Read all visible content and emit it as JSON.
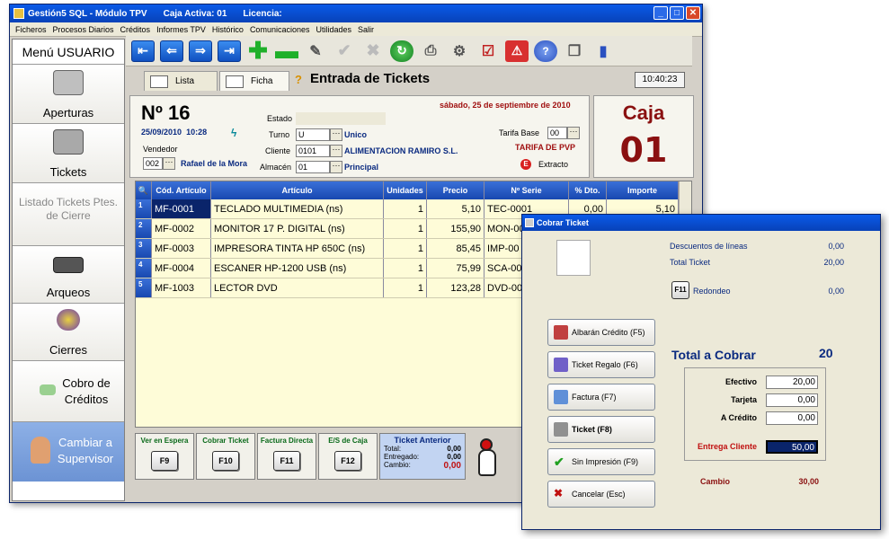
{
  "window": {
    "app_title": "Gestión5 SQL - Módulo TPV",
    "caja_activa": "Caja Activa: 01",
    "licencia": "Licencia:"
  },
  "menu": [
    "Ficheros",
    "Procesos Diarios",
    "Créditos",
    "Informes TPV",
    "Histórico",
    "Comunicaciones",
    "Utilidades",
    "Salir"
  ],
  "sidebar": {
    "title": "Menú USUARIO",
    "items": [
      {
        "label": "Aperturas",
        "icon": "register-icon"
      },
      {
        "label": "Tickets",
        "icon": "cash-register-icon"
      },
      {
        "label": "Listado Tickets Ptes. de Cierre",
        "icon": ""
      },
      {
        "label": "Arqueos",
        "icon": "cash-drawer-icon"
      },
      {
        "label": "Cierres",
        "icon": "gears-icon"
      },
      {
        "label": "Cobro de Créditos",
        "icon": "money-icon"
      },
      {
        "label": "Cambiar a Supervisor",
        "icon": "user-icon"
      }
    ]
  },
  "tabs": {
    "lista": "Lista",
    "ficha": "Ficha"
  },
  "page_title": "Entrada de Tickets",
  "clock": "10:40:23",
  "ticket": {
    "number": "Nº 16",
    "date": "25/09/2010",
    "time": "10:28",
    "long_date": "sábado, 25 de septiembre de 2010",
    "vendedor_label": "Vendedor",
    "vendedor_code": "002",
    "vendedor_name": "Rafael de la Mora",
    "estado_label": "Estado",
    "turno_label": "Turno",
    "turno_code": "U",
    "turno_name": "Unico",
    "cliente_label": "Cliente",
    "cliente_code": "0101",
    "cliente_name": "ALIMENTACION RAMIRO S.L.",
    "almacen_label": "Almacén",
    "almacen_code": "01",
    "almacen_name": "Principal",
    "tarifa_label": "Tarifa Base",
    "tarifa_code": "00",
    "tarifa_name": "TARIFA DE PVP",
    "extracto": "Extracto"
  },
  "caja": {
    "label": "Caja",
    "number": "01"
  },
  "grid": {
    "headers": [
      "Cód. Artículo",
      "Artículo",
      "Unidades",
      "Precio",
      "Nº Serie",
      "% Dto.",
      "Importe"
    ],
    "rows": [
      {
        "n": "1",
        "cod": "MF-0001",
        "art": "TECLADO MULTIMEDIA  (ns)",
        "uni": "1",
        "precio": "5,10",
        "serie": "TEC-0001",
        "dto": "0,00",
        "imp": "5,10"
      },
      {
        "n": "2",
        "cod": "MF-0002",
        "art": "MONITOR 17 P. DIGITAL  (ns)",
        "uni": "1",
        "precio": "155,90",
        "serie": "MON-00",
        "dto": "",
        "imp": ""
      },
      {
        "n": "3",
        "cod": "MF-0003",
        "art": "IMPRESORA TINTA HP 650C  (ns)",
        "uni": "1",
        "precio": "85,45",
        "serie": "IMP-00",
        "dto": "",
        "imp": ""
      },
      {
        "n": "4",
        "cod": "MF-0004",
        "art": "ESCANER HP-1200 USB  (ns)",
        "uni": "1",
        "precio": "75,99",
        "serie": "SCA-00",
        "dto": "",
        "imp": ""
      },
      {
        "n": "5",
        "cod": "MF-1003",
        "art": "LECTOR DVD",
        "uni": "1",
        "precio": "123,28",
        "serie": "DVD-00",
        "dto": "",
        "imp": ""
      }
    ]
  },
  "fkeys": [
    {
      "label": "Ver en Espera",
      "key": "F9"
    },
    {
      "label": "Cobrar Ticket",
      "key": "F10"
    },
    {
      "label": "Factura Directa",
      "key": "F11"
    },
    {
      "label": "E/S de Caja",
      "key": "F12"
    }
  ],
  "prev_ticket": {
    "title": "Ticket Anterior",
    "total_label": "Total:",
    "total": "0,00",
    "entregado_label": "Entregado:",
    "entregado": "0,00",
    "cambio_label": "Cambio:",
    "cambio": "0,00"
  },
  "dialog": {
    "title": "Cobrar Ticket",
    "descuentos_label": "Descuentos de líneas",
    "descuentos": "0,00",
    "total_ticket_label": "Total Ticket",
    "total_ticket": "20,00",
    "redondeo_key": "F11",
    "redondeo_label": "Redondeo",
    "redondeo": "0,00",
    "buttons": [
      "Albarán Crédito (F5)",
      "Ticket Regalo (F6)",
      "Factura (F7)",
      "Ticket (F8)",
      "Sin Impresión (F9)",
      "Cancelar (Esc)"
    ],
    "total_cobrar_label": "Total a Cobrar",
    "total_cobrar": "20",
    "efectivo_label": "Efectivo",
    "efectivo": "20,00",
    "tarjeta_label": "Tarjeta",
    "tarjeta": "0,00",
    "credito_label": "A Crédito",
    "credito": "0,00",
    "entrega_label": "Entrega Cliente",
    "entrega": "50,00",
    "cambio_label": "Cambio",
    "cambio": "30,00"
  }
}
